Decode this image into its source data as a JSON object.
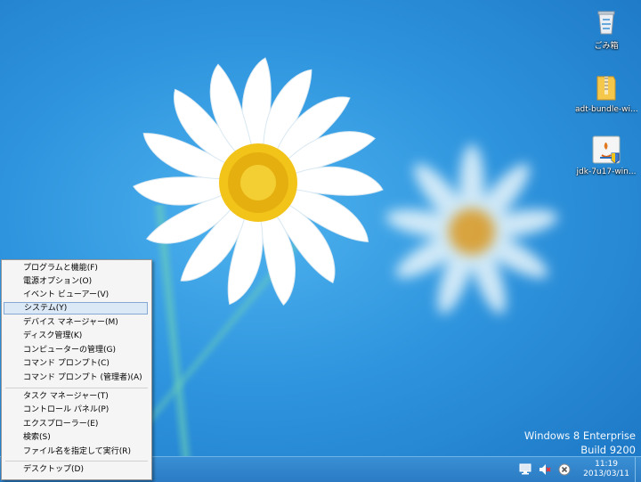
{
  "desktop": {
    "wallpaper": "daisy flowers on blue",
    "icons": [
      {
        "label": "ごみ箱",
        "icon": "recycle-bin-icon"
      },
      {
        "label": "adt-bundle-wi...",
        "icon": "zip-folder-icon"
      },
      {
        "label": "jdk-7u17-win...",
        "icon": "java-installer-icon"
      }
    ],
    "watermark": {
      "line1": "Windows 8 Enterprise",
      "line2": "Build 9200"
    }
  },
  "context_menu": {
    "groups": [
      [
        "プログラムと機能(F)",
        "電源オプション(O)",
        "イベント ビューアー(V)",
        "システム(Y)",
        "デバイス マネージャー(M)",
        "ディスク管理(K)",
        "コンピューターの管理(G)",
        "コマンド プロンプト(C)",
        "コマンド プロンプト (管理者)(A)"
      ],
      [
        "タスク マネージャー(T)",
        "コントロール パネル(P)",
        "エクスプローラー(E)",
        "検索(S)",
        "ファイル名を指定して実行(R)"
      ],
      [
        "デスクトップ(D)"
      ]
    ],
    "highlighted": "システム(Y)"
  },
  "taskbar": {
    "tray_icons": [
      "network-icon",
      "volume-muted-icon",
      "action-center-icon"
    ],
    "clock": {
      "time": "11:19",
      "date": "2013/03/11"
    }
  },
  "colors": {
    "desktop_blue": "#2f95de",
    "taskbar": "#2a7bc3",
    "menu_bg": "#f5f5f5",
    "highlight": "#dbe8f6"
  }
}
